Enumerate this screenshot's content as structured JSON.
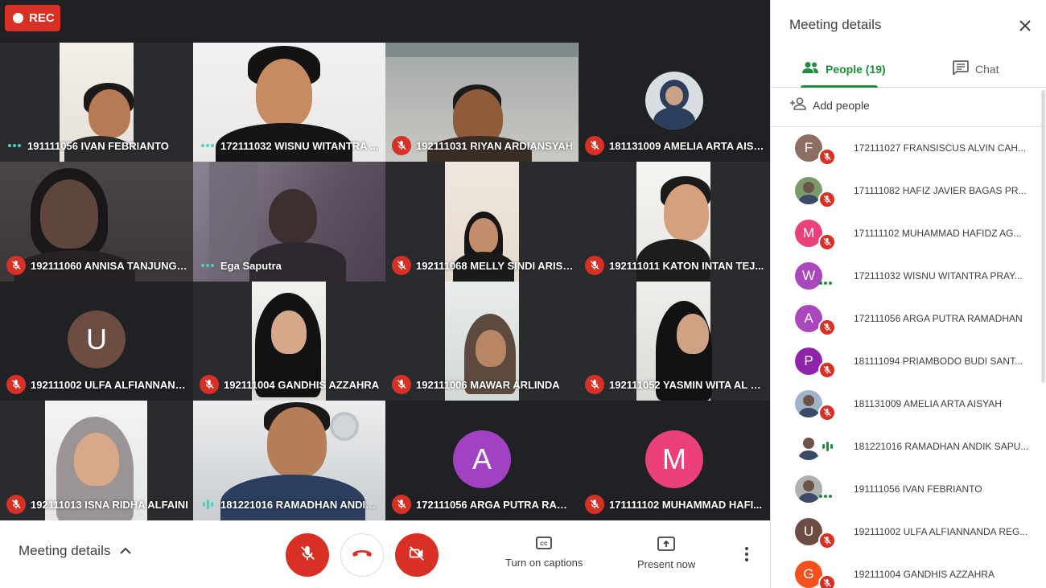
{
  "recording": {
    "label": "REC"
  },
  "tiles": [
    {
      "name": "191111056 IVAN FEBRIANTO",
      "status": "dots"
    },
    {
      "name": "172111032 WISNU WITANTRA ...",
      "status": "dots"
    },
    {
      "name": "192111031 RIYAN ARDIANSYAH",
      "status": "muted"
    },
    {
      "name": "181131009 AMELIA ARTA AISY...",
      "status": "muted"
    },
    {
      "name": "192111060 ANNISA TANJUNG ...",
      "status": "muted"
    },
    {
      "name": "Ega Saputra",
      "status": "dots"
    },
    {
      "name": "192111068 MELLY SINDI ARISK...",
      "status": "muted"
    },
    {
      "name": "192111011 KATON INTAN TEJ...",
      "status": "muted"
    },
    {
      "name": "192111002 ULFA ALFIANNAND...",
      "status": "muted",
      "avatar_letter": "U",
      "avatar_color": "#6d4c41"
    },
    {
      "name": "192111004 GANDHIS AZZAHRA",
      "status": "muted"
    },
    {
      "name": "192111006 MAWAR ARLINDA",
      "status": "muted"
    },
    {
      "name": "192111052 YASMIN WITA AL H...",
      "status": "muted"
    },
    {
      "name": "192111013 ISNA RIDHA ALFAINI",
      "status": "muted"
    },
    {
      "name": "181221016 RAMADHAN ANDIK...",
      "status": "speaking"
    },
    {
      "name": "172111056 ARGA PUTRA RAM...",
      "status": "muted",
      "avatar_letter": "A",
      "avatar_color": "#a142c2"
    },
    {
      "name": "171111102 MUHAMMAD HAFI...",
      "status": "muted",
      "avatar_letter": "M",
      "avatar_color": "#ec407a"
    }
  ],
  "bottom_bar": {
    "meeting_details_label": "Meeting details",
    "captions_label": "Turn on captions",
    "present_label": "Present now"
  },
  "panel": {
    "title": "Meeting details",
    "tabs": {
      "people": "People (19)",
      "chat": "Chat"
    },
    "add_people_label": "Add people",
    "people": [
      {
        "name": "172111027 FRANSISCUS ALVIN CAH...",
        "avatar_letter": "F",
        "avatar_color": "#8d6e63",
        "status": "muted"
      },
      {
        "name": "171111082 HAFIZ JAVIER BAGAS PR...",
        "avatar_letter": "",
        "avatar_color": "#7a9a6a",
        "status": "muted"
      },
      {
        "name": "171111102 MUHAMMAD HAFIDZ AG...",
        "avatar_letter": "M",
        "avatar_color": "#ec407a",
        "status": "muted"
      },
      {
        "name": "172111032 WISNU WITANTRA PRAY...",
        "avatar_letter": "W",
        "avatar_color": "#ab47bc",
        "status": "dots"
      },
      {
        "name": "172111056 ARGA PUTRA RAMADHAN",
        "avatar_letter": "A",
        "avatar_color": "#ab47bc",
        "status": "muted"
      },
      {
        "name": "181111094 PRIAMBODO BUDI SANT...",
        "avatar_letter": "P",
        "avatar_color": "#8e24aa",
        "status": "muted"
      },
      {
        "name": "181131009 AMELIA ARTA AISYAH",
        "avatar_letter": "",
        "avatar_color": "#9fb4c8",
        "status": "muted"
      },
      {
        "name": "181221016 RAMADHAN ANDIK SAPU...",
        "avatar_letter": "",
        "avatar_color": "#ffffff",
        "status": "speaking"
      },
      {
        "name": "191111056 IVAN FEBRIANTO",
        "avatar_letter": "",
        "avatar_color": "#b0b0b0",
        "status": "dots"
      },
      {
        "name": "192111002 ULFA ALFIANNANDA REG...",
        "avatar_letter": "U",
        "avatar_color": "#6d4c41",
        "status": "muted"
      },
      {
        "name": "192111004 GANDHIS AZZAHRA",
        "avatar_letter": "G",
        "avatar_color": "#f4511e",
        "status": "muted"
      }
    ]
  }
}
